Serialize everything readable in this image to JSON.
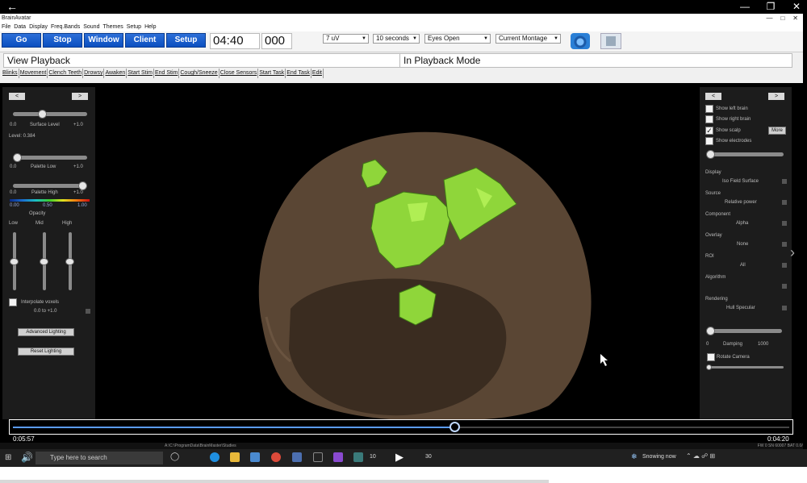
{
  "window": {
    "app_title": "BrainAvatar"
  },
  "menu": [
    "File",
    "Data",
    "Display",
    "Freq.Bands",
    "Sound",
    "Themes",
    "Setup",
    "Help"
  ],
  "toolbar": {
    "go": "Go",
    "stop": "Stop",
    "window": "Window",
    "client": "Client",
    "setup": "Setup",
    "time": "04:40",
    "counter": "000",
    "scale": "7 uV",
    "duration": "10 seconds",
    "condition": "Eyes Open",
    "montage": "Current Montage"
  },
  "status": {
    "left": "View Playback",
    "right": "In Playback Mode"
  },
  "event_buttons": [
    "Blinks",
    "Movement",
    "Clench Teeth",
    "Drowsy",
    "Awaken",
    "Start Stim",
    "End Stim",
    "Cough/Sneeze",
    "Close Sensors",
    "Start Task",
    "End Task",
    "Edit"
  ],
  "left_panel": {
    "prev": "<",
    "next": ">",
    "surface_min": "0.0",
    "surface_label": "Surface Level",
    "surface_max": "+1.0",
    "surface_value": 0.384,
    "level_text": "Level: 0.384",
    "palette_low_min": "0.0",
    "palette_low_label": "Palette Low",
    "palette_low_max": "+1.0",
    "palette_low_value": 0.0,
    "palette_high_min": "0.0",
    "palette_high_label": "Palette High",
    "palette_high_max": "+1.0",
    "palette_high_value": 1.0,
    "opacity_min": "0.00",
    "opacity_mid": "0.50",
    "opacity_max": "1.00",
    "opacity_label": "Opacity",
    "band_low": "Low",
    "band_mid": "Mid",
    "band_high": "High",
    "band_low_value": 0.5,
    "band_mid_value": 0.5,
    "band_high_value": 0.5,
    "interpolate_label": "Interpolate voxels",
    "range_text": "0.0 to +1.0",
    "advanced_lighting": "Advanced Lighting",
    "reset_lighting": "Reset Lighting"
  },
  "right_panel": {
    "prev": "<",
    "next": ">",
    "show_left_brain": "Show left brain",
    "show_right_brain": "Show right brain",
    "show_scalp": "Show scalp",
    "show_electrodes": "Show electrodes",
    "more": "More",
    "display_label": "Display",
    "display_value": "Iso Field Surface",
    "source_label": "Source",
    "source_value": "Relative power",
    "component_label": "Component",
    "component_value": "Alpha",
    "overlay_label": "Overlay",
    "overlay_value": "None",
    "roi_label": "ROI",
    "roi_value": "All",
    "algorithm_label": "Algorithm",
    "rendering_label": "Rendering",
    "rendering_value": "Hull Specular",
    "damping_min": "0",
    "damping_label": "Damping",
    "damping_max": "1000",
    "rotate_camera": "Rotate Camera"
  },
  "player": {
    "elapsed": "0:05:57",
    "remaining": "0:04:20",
    "progress": 0.57
  },
  "app_status": {
    "path": "A:\\C:\\ProgramData\\BrainMaster\\Studies",
    "right": "FW 0 SN 60007 BAT 0.0/014"
  },
  "taskbar": {
    "search": "Type here to search",
    "weather": "Snowing now",
    "rewind": "10",
    "forward": "30"
  },
  "colors": {
    "brain_shell": "#5a4634",
    "activation": "#8fd63a",
    "button_blue": "#0a4fc0"
  }
}
